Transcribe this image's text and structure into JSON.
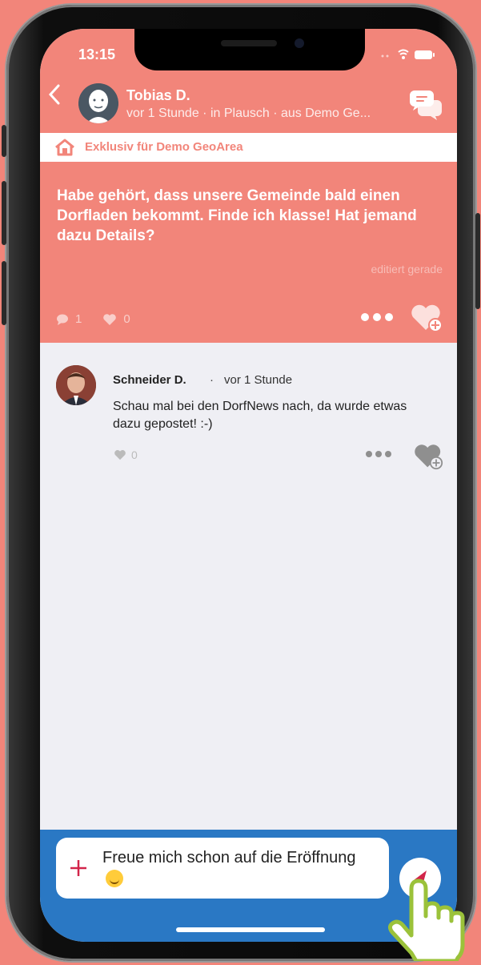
{
  "status_bar": {
    "time": "13:15"
  },
  "header": {
    "author_name": "Tobias D.",
    "meta": "vor 1 Stunde · in Plausch · aus Demo Ge..."
  },
  "banner": {
    "text": "Exklusiv für Demo GeoArea"
  },
  "post": {
    "text": "Habe gehört, dass unsere Gemeinde bald einen Dorfladen bekommt. Finde ich klasse! Hat jemand dazu Details?",
    "edited": "editiert gerade",
    "comment_count": "1",
    "like_count": "0"
  },
  "comment": {
    "author": "Schneider D.",
    "separator": "·",
    "time": "vor 1 Stunde",
    "text": "Schau mal bei den DorfNews nach, da wurde etwas dazu gepostet! :-)",
    "like_count": "0"
  },
  "composer": {
    "text": "Freue mich schon auf die Eröffnung"
  },
  "colors": {
    "accent": "#f2857a",
    "composer_bg": "#2a78c4",
    "plus": "#d2254a"
  },
  "icons": [
    "back-chevron-icon",
    "chat-bubbles-icon",
    "home-icon",
    "comment-icon",
    "heart-icon",
    "more-icon",
    "heart-add-icon",
    "plus-icon",
    "send-icon",
    "hand-pointer-icon"
  ]
}
